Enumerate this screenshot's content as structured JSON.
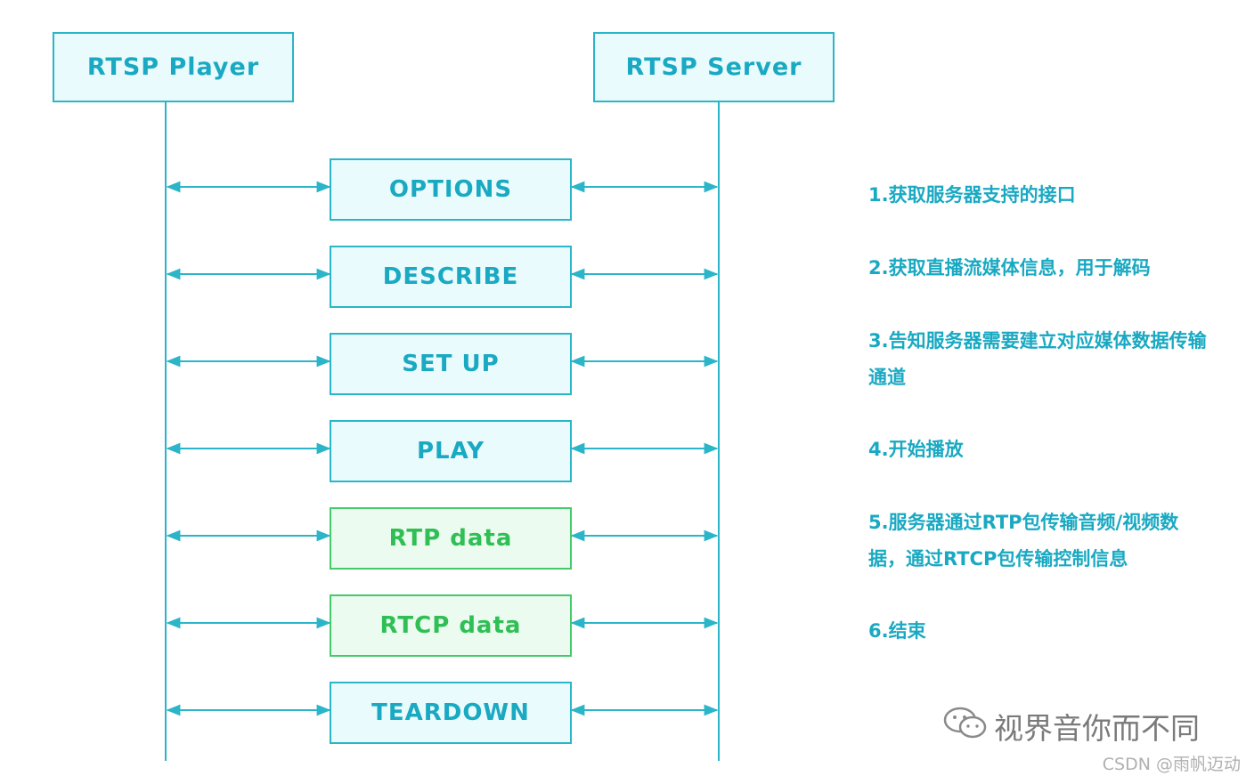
{
  "actors": {
    "player": "RTSP Player",
    "server": "RTSP Server"
  },
  "messages": [
    {
      "label": "OPTIONS",
      "type": "control"
    },
    {
      "label": "DESCRIBE",
      "type": "control"
    },
    {
      "label": "SET UP",
      "type": "control"
    },
    {
      "label": "PLAY",
      "type": "control"
    },
    {
      "label": "RTP data",
      "type": "data"
    },
    {
      "label": "RTCP data",
      "type": "data"
    },
    {
      "label": "TEARDOWN",
      "type": "control"
    }
  ],
  "notes": [
    "1.获取服务器支持的接口",
    "2.获取直播流媒体信息，用于解码",
    "3.告知服务器需要建立对应媒体数据传输通道",
    "4.开始播放",
    "5.服务器通过RTP包传输音频/视频数据，通过RTCP包传输控制信息",
    "6.结束"
  ],
  "watermark": {
    "text": "视界音你而不同",
    "icon": "wechat-icon",
    "credit": "CSDN @雨帆迈动"
  },
  "colors": {
    "teal": "#2bb5c8",
    "teal_text": "#1aa9c2",
    "green": "#44c96b",
    "green_text": "#2fbf55"
  }
}
